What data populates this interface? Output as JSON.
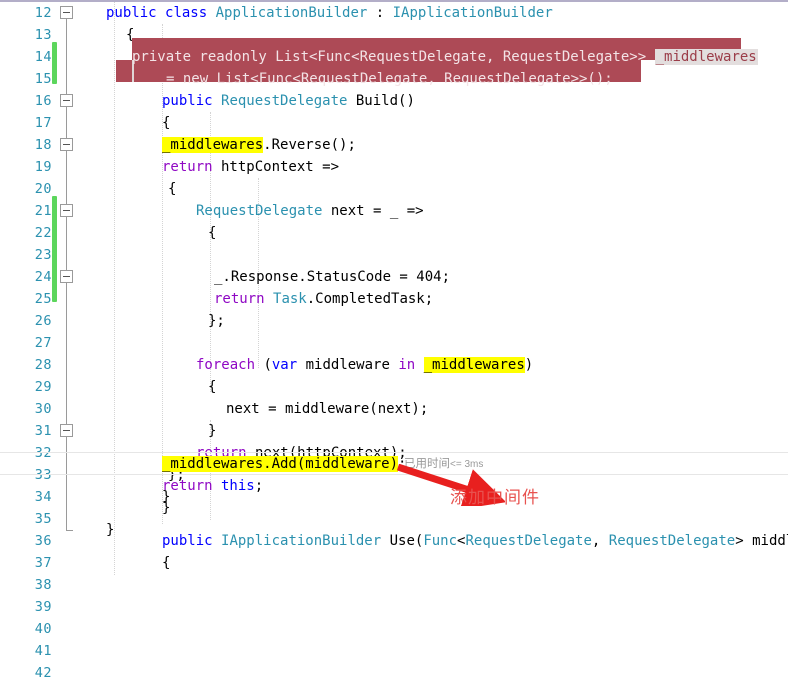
{
  "editor": {
    "language": "csharp",
    "first_line": 12,
    "last_line": 42,
    "colors": {
      "keyword": "#0000ff",
      "type": "#2b91af",
      "control": "#8f08c4",
      "line_number": "#2b91af",
      "selection_bg": "#ad4a56",
      "find_highlight": "#ffff00",
      "change_bar": "#5cd65c",
      "annotation": "#e8524f",
      "codelens_text": "#9a9a9a",
      "top_border": "#b3aec8"
    }
  },
  "gutter": {
    "line_numbers": [
      12,
      13,
      14,
      15,
      16,
      17,
      18,
      19,
      20,
      21,
      22,
      23,
      24,
      25,
      26,
      27,
      28,
      29,
      30,
      31,
      32,
      33,
      34,
      35,
      36,
      37,
      38,
      39,
      40,
      41,
      42
    ],
    "fold_markers": [
      {
        "line": 12,
        "state": "expanded"
      },
      {
        "line": 16,
        "state": "expanded"
      },
      {
        "line": 19,
        "state": "expanded"
      },
      {
        "line": 21,
        "state": "expanded"
      },
      {
        "line": 27,
        "state": "expanded"
      },
      {
        "line": 35,
        "state": "expanded"
      }
    ],
    "change_bars": [
      {
        "from_line": 14,
        "to_line": 15
      },
      {
        "from_line": 21,
        "to_line": 25
      }
    ]
  },
  "code": {
    "lines": [
      {
        "n": 12,
        "indent": 2,
        "text": "public class ApplicationBuilder : IApplicationBuilder"
      },
      {
        "n": 13,
        "indent": 2,
        "text": "{"
      },
      {
        "n": 14,
        "indent": 4,
        "text": "private readonly List<Func<RequestDelegate, RequestDelegate>> _middlewares"
      },
      {
        "n": 15,
        "indent": 8,
        "text": "= new List<Func<RequestDelegate, RequestDelegate>>();"
      },
      {
        "n": 16,
        "indent": 4,
        "text": "public RequestDelegate Build()"
      },
      {
        "n": 17,
        "indent": 4,
        "text": "{"
      },
      {
        "n": 18,
        "indent": 6,
        "text": "_middlewares.Reverse();"
      },
      {
        "n": 19,
        "indent": 6,
        "text": "return httpContext =>"
      },
      {
        "n": 20,
        "indent": 6,
        "text": "{"
      },
      {
        "n": 21,
        "indent": 8,
        "text": "RequestDelegate next = _ =>"
      },
      {
        "n": 22,
        "indent": 8,
        "text": "{"
      },
      {
        "n": 23,
        "indent": 10,
        "text": ""
      },
      {
        "n": 24,
        "indent": 10,
        "text": "_.Response.StatusCode = 404;"
      },
      {
        "n": 25,
        "indent": 10,
        "text": "return Task.CompletedTask;"
      },
      {
        "n": 26,
        "indent": 8,
        "text": "};"
      },
      {
        "n": 27,
        "indent": 8,
        "text": ""
      },
      {
        "n": 28,
        "indent": 8,
        "text": "foreach (var middleware in _middlewares)"
      },
      {
        "n": 29,
        "indent": 8,
        "text": "{"
      },
      {
        "n": 30,
        "indent": 10,
        "text": "next = middleware(next);"
      },
      {
        "n": 31,
        "indent": 8,
        "text": "}"
      },
      {
        "n": 32,
        "indent": 8,
        "text": "return next(httpContext);"
      },
      {
        "n": 33,
        "indent": 6,
        "text": "};"
      },
      {
        "n": 34,
        "indent": 4,
        "text": "}"
      },
      {
        "n": 35,
        "indent": 4,
        "text": ""
      },
      {
        "n": 36,
        "indent": 4,
        "text": "public IApplicationBuilder Use(Func<RequestDelegate, RequestDelegate> middleware)"
      },
      {
        "n": 37,
        "indent": 4,
        "text": "{"
      },
      {
        "n": 38,
        "indent": 6,
        "text": "_middlewares.Add(middleware);"
      },
      {
        "n": 39,
        "indent": 6,
        "text": "return this;"
      },
      {
        "n": 40,
        "indent": 4,
        "text": "}"
      },
      {
        "n": 41,
        "indent": 2,
        "text": "}"
      },
      {
        "n": 42,
        "indent": 0,
        "text": ""
      }
    ],
    "tokens": {
      "l12_kw1": "public",
      "l12_kw2": "class",
      "l12_type": "ApplicationBuilder",
      "l12_colon": " : ",
      "l12_iface": "IApplicationBuilder",
      "l13_brace": "{",
      "l14_sel": "private readonly List<Func<RequestDelegate, RequestDelegate>> ",
      "l14_ident": "_middlewares",
      "l15_sel": "= new List<Func<RequestDelegate, RequestDelegate>>();",
      "l16_kw": "public",
      "l16_type": "RequestDelegate",
      "l16_name": " Build()",
      "l17_brace": "{",
      "l18_hl": "_middlewares",
      "l18_rest": ".Reverse();",
      "l19_kw": "return",
      "l19_rest": " httpContext =>",
      "l20_brace": "{",
      "l21_type": "RequestDelegate",
      "l21_rest": " next = _ =>",
      "l22_brace": "{",
      "l24_text": "_.Response.StatusCode = 404;",
      "l25_kw": "return",
      "l25_type": "Task",
      "l25_rest": ".CompletedTask;",
      "l26_text": "};",
      "l28_kw": "foreach",
      "l28_open": " (",
      "l28_var": "var",
      "l28_mid": " middleware ",
      "l28_in": "in",
      "l28_sp": " ",
      "l28_hl": "_middlewares",
      "l28_close": ")",
      "l29_brace": "{",
      "l30_text": "next = middleware(next);",
      "l31_brace": "}",
      "l32_kw": "return",
      "l32_rest": " next(httpContext);",
      "l33_text": "};",
      "l34_brace": "}",
      "l36_kw": "public",
      "l36_type": "IApplicationBuilder",
      "l36_use": " Use(",
      "l36_func": "Func",
      "l36_lt": "<",
      "l36_rd1": "RequestDelegate",
      "l36_comma": ", ",
      "l36_rd2": "RequestDelegate",
      "l36_gt": ">",
      "l36_param": " middleware)",
      "l37_brace": "{",
      "l38_hl": "_middlewares.Add(middleware)",
      "l38_semi": ";",
      "l39_kw": "return",
      "l39_this": " this",
      "l39_semi": ";",
      "l40_brace": "}",
      "l41_brace": "}"
    }
  },
  "codelens": {
    "label": "已用时间",
    "value": "<= 3ms"
  },
  "annotation": {
    "text": "添加中间件",
    "arrow": "red-arrow"
  }
}
